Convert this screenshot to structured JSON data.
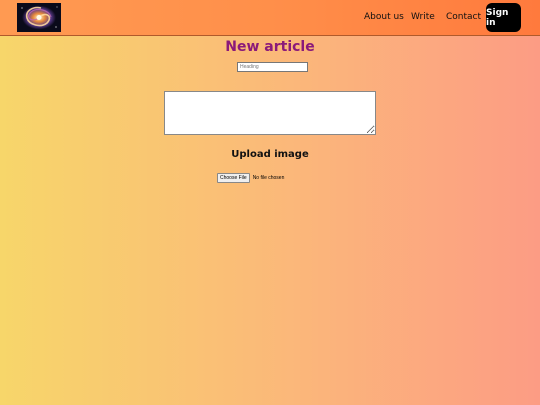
{
  "navbar": {
    "logo_icon": "galaxy-logo",
    "links": [
      {
        "label": "About us"
      },
      {
        "label": "Write"
      },
      {
        "label": "Contact"
      }
    ],
    "signin_label": "Sign in"
  },
  "main": {
    "title": "New article",
    "heading_placeholder": "Heading",
    "heading_value": "",
    "body_value": "",
    "upload_title": "Upload image",
    "file_button_label": "Choose File",
    "file_status": "No file chosen"
  },
  "colors": {
    "navbar": "#ff8f4a",
    "title": "#8b1a7a",
    "background_left": "#f7d66a",
    "background_right": "#fc9c84",
    "signin_bg": "#000000"
  }
}
